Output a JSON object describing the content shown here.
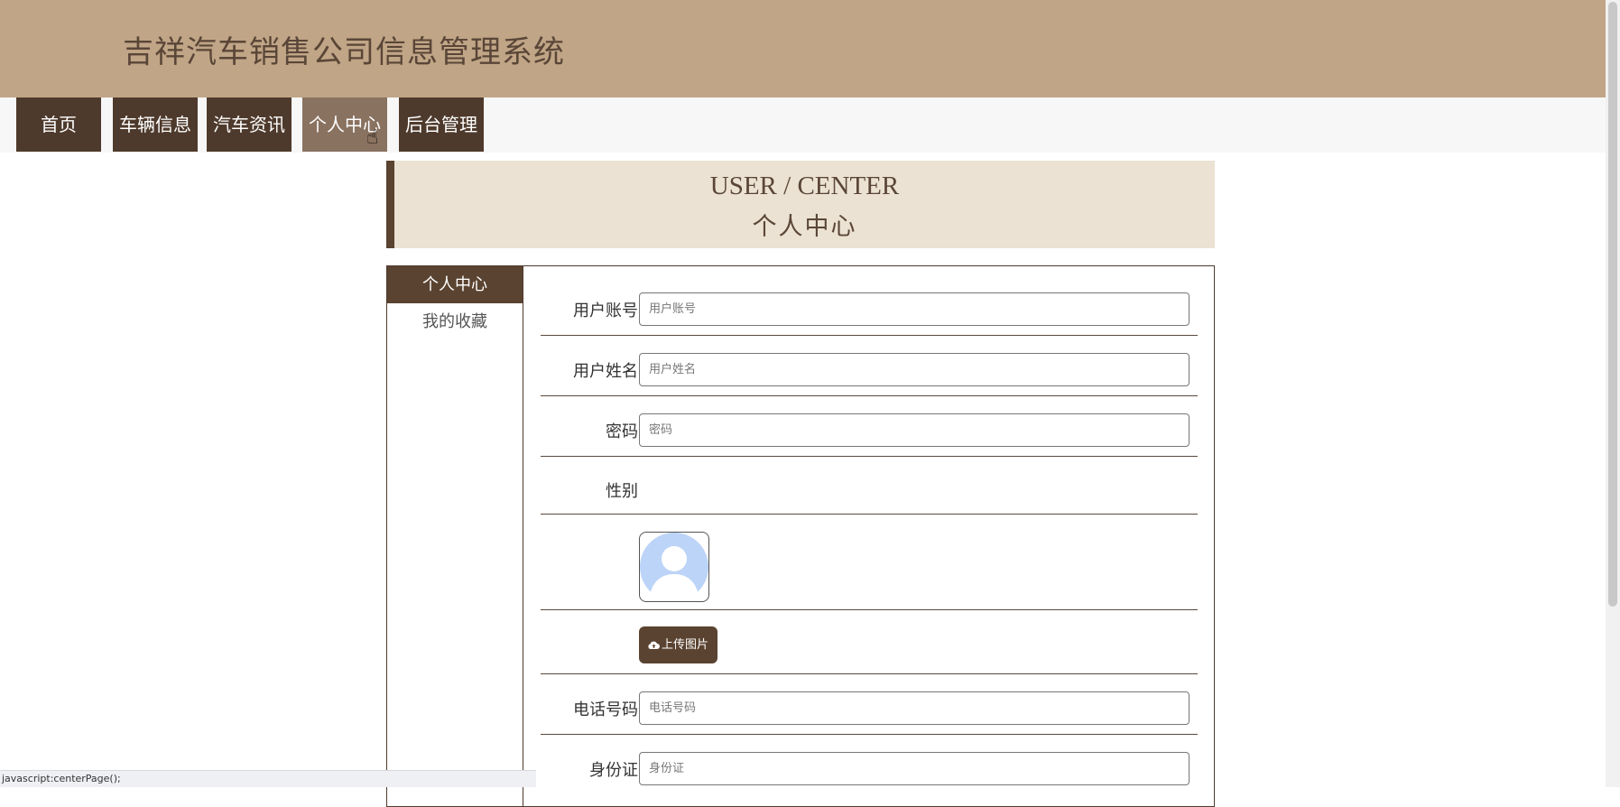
{
  "site": {
    "title": "吉祥汽车销售公司信息管理系统"
  },
  "nav": {
    "items": [
      {
        "label": "首页"
      },
      {
        "label": "车辆信息"
      },
      {
        "label": "汽车资讯"
      },
      {
        "label": "个人中心",
        "active": true
      },
      {
        "label": "后台管理"
      }
    ]
  },
  "banner": {
    "title_en": "USER / CENTER",
    "title_cn": "个人中心"
  },
  "sidebar": {
    "items": [
      {
        "label": "个人中心",
        "active": true
      },
      {
        "label": "我的收藏"
      }
    ]
  },
  "form": {
    "account": {
      "label": "用户账号",
      "placeholder": "用户账号",
      "value": ""
    },
    "name": {
      "label": "用户姓名",
      "placeholder": "用户姓名",
      "value": ""
    },
    "password": {
      "label": "密码",
      "placeholder": "密码",
      "value": ""
    },
    "gender": {
      "label": "性别"
    },
    "upload_label": "上传图片",
    "phone": {
      "label": "电话号码",
      "placeholder": "电话号码",
      "value": ""
    },
    "idcard": {
      "label": "身份证",
      "placeholder": "身份证",
      "value": ""
    }
  },
  "status_bar": {
    "text": "javascript:centerPage();"
  },
  "colors": {
    "header_bg": "#c0a586",
    "nav_item_bg": "#4e3a2c",
    "nav_active_bg": "#8a7260",
    "banner_bg": "#ebe2d3",
    "accent": "#5a4330"
  }
}
